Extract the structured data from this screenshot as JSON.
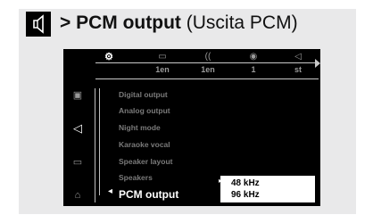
{
  "heading": {
    "prefix": ">",
    "title": "PCM output",
    "subtitle": "(Uscita PCM)"
  },
  "top_menu": [
    {
      "icon": "settings-icon",
      "glyph": "⚙",
      "value": ""
    },
    {
      "icon": "subtitle-icon",
      "glyph": "▭",
      "value": "1en"
    },
    {
      "icon": "audio-language-icon",
      "glyph": "((",
      "value": "1en"
    },
    {
      "icon": "angle-icon",
      "glyph": "◉",
      "value": "1"
    },
    {
      "icon": "speaker-icon",
      "glyph": "◁",
      "value": "st"
    }
  ],
  "side_menu": [
    {
      "icon": "display-icon",
      "glyph": "▣",
      "selected": false
    },
    {
      "icon": "audio-speaker-icon",
      "glyph": "◁",
      "selected": true
    },
    {
      "icon": "subtitle-settings-icon",
      "glyph": "▭",
      "selected": false
    },
    {
      "icon": "parental-lock-icon",
      "glyph": "⌂",
      "selected": false
    }
  ],
  "menu_items": [
    "Digital output",
    "Analog output",
    "Night mode",
    "Karaoke vocal",
    "Speaker layout",
    "Speakers",
    "PCM output"
  ],
  "dropdown": {
    "options": [
      "48 kHz",
      "96 kHz"
    ]
  }
}
